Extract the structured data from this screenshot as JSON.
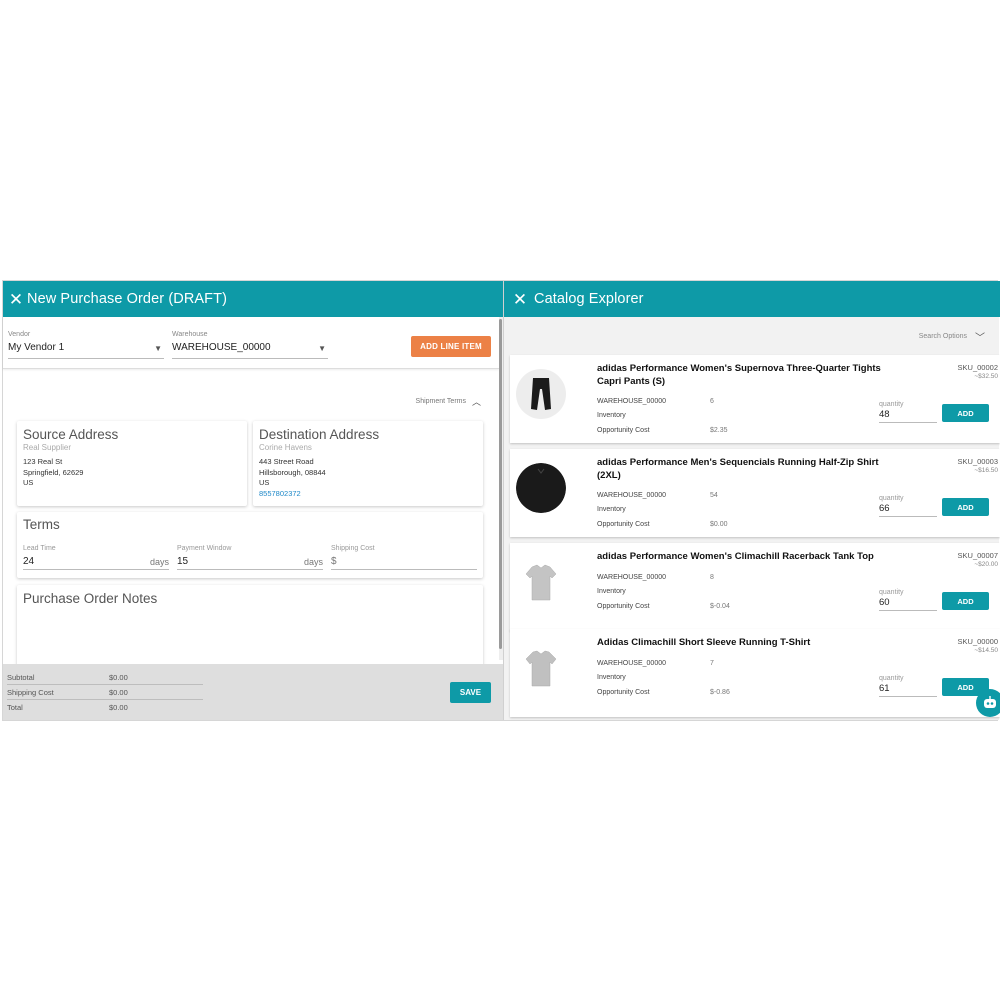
{
  "left": {
    "title": "New Purchase Order (DRAFT)",
    "vendor": {
      "label": "Vendor",
      "value": "My Vendor 1"
    },
    "warehouse": {
      "label": "Warehouse",
      "value": "WAREHOUSE_00000"
    },
    "add_line_item_label": "ADD LINE ITEM",
    "shipment_terms_label": "Shipment Terms",
    "source": {
      "title": "Source Address",
      "name": "Real Supplier",
      "street": "123 Real St",
      "city": "Springfield, 62629",
      "country": "US"
    },
    "destination": {
      "title": "Destination Address",
      "name": "Corine Havens",
      "street": "443 Street Road",
      "city": "Hillsborough, 08844",
      "country": "US",
      "phone": "8557802372"
    },
    "terms": {
      "title": "Terms",
      "lead_time": {
        "label": "Lead Time",
        "value": "24",
        "unit": "days"
      },
      "payment_window": {
        "label": "Payment Window",
        "value": "15",
        "unit": "days"
      },
      "shipping_cost": {
        "label": "Shipping Cost",
        "value": "$"
      }
    },
    "notes_title": "Purchase Order Notes",
    "totals": {
      "subtotal": {
        "label": "Subtotal",
        "value": "$0.00"
      },
      "shipping": {
        "label": "Shipping Cost",
        "value": "$0.00"
      },
      "total": {
        "label": "Total",
        "value": "$0.00"
      }
    },
    "save_label": "SAVE"
  },
  "right": {
    "title": "Catalog Explorer",
    "search_options_label": "Search Options",
    "products": [
      {
        "name": "adidas Performance Women's Supernova Three-Quarter Tights Capri Pants (S)",
        "sku": "SKU_00002",
        "price": "~$32.50",
        "warehouse": "WAREHOUSE_00000",
        "warehouse_qty": "6",
        "inventory_label": "Inventory",
        "opp_label": "Opportunity Cost",
        "opp_value": "$2.35",
        "quantity_label": "quantity",
        "quantity": "48",
        "add_label": "ADD"
      },
      {
        "name": "adidas Performance Men's Sequencials Running Half-Zip Shirt (2XL)",
        "sku": "SKU_00003",
        "price": "~$16.50",
        "warehouse": "WAREHOUSE_00000",
        "warehouse_qty": "54",
        "inventory_label": "Inventory",
        "opp_label": "Opportunity Cost",
        "opp_value": "$0.00",
        "quantity_label": "quantity",
        "quantity": "66",
        "add_label": "ADD"
      },
      {
        "name": "adidas Performance Women's Climachill Racerback Tank Top",
        "sku": "SKU_00007",
        "price": "~$20.00",
        "warehouse": "WAREHOUSE_00000",
        "warehouse_qty": "8",
        "inventory_label": "Inventory",
        "opp_label": "Opportunity Cost",
        "opp_value": "$-0.04",
        "quantity_label": "quantity",
        "quantity": "60",
        "add_label": "ADD"
      },
      {
        "name": "Adidas Climachill Short Sleeve Running T-Shirt",
        "sku": "SKU_00000",
        "price": "~$14.50",
        "warehouse": "WAREHOUSE_00000",
        "warehouse_qty": "7",
        "inventory_label": "Inventory",
        "opp_label": "Opportunity Cost",
        "opp_value": "$-0.86",
        "quantity_label": "quantity",
        "quantity": "61",
        "add_label": "ADD"
      }
    ]
  },
  "colors": {
    "header": "#0e9aa7",
    "accent_orange": "#ec8146",
    "link_blue": "#1e88c8"
  }
}
